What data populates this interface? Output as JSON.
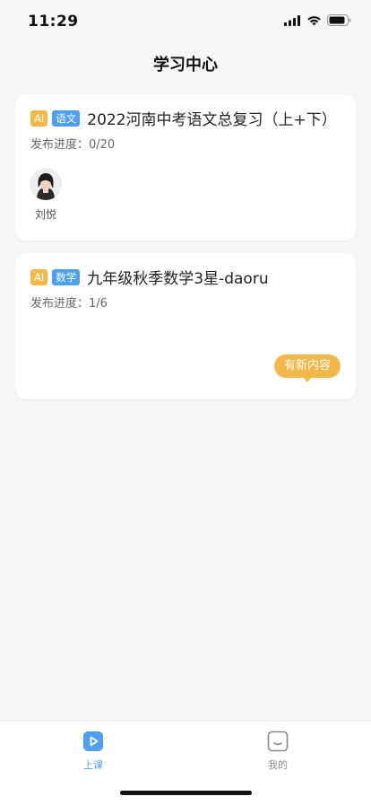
{
  "status_bar": {
    "time": "11:29"
  },
  "nav": {
    "title": "学习中心"
  },
  "courses": [
    {
      "tag_ai": "AI",
      "tag_subject": "语文",
      "title": "2022河南中考语文总复习（上+下）",
      "progress": "发布进度：0/20",
      "teacher_name": "刘悦"
    },
    {
      "tag_ai": "AI",
      "tag_subject": "数学",
      "title": "九年级秋季数学3星-daoru",
      "progress": "发布进度：1/6",
      "badge": "有新内容"
    }
  ],
  "tabbar": {
    "items": [
      {
        "label": "上课",
        "icon": "play-icon",
        "active": true
      },
      {
        "label": "我的",
        "icon": "smile-face-icon",
        "active": false
      }
    ]
  },
  "colors": {
    "accent": "#4e9ff0",
    "ai_tag": "#f0b94a",
    "badge": "#f3b648",
    "inactive": "#888888"
  }
}
